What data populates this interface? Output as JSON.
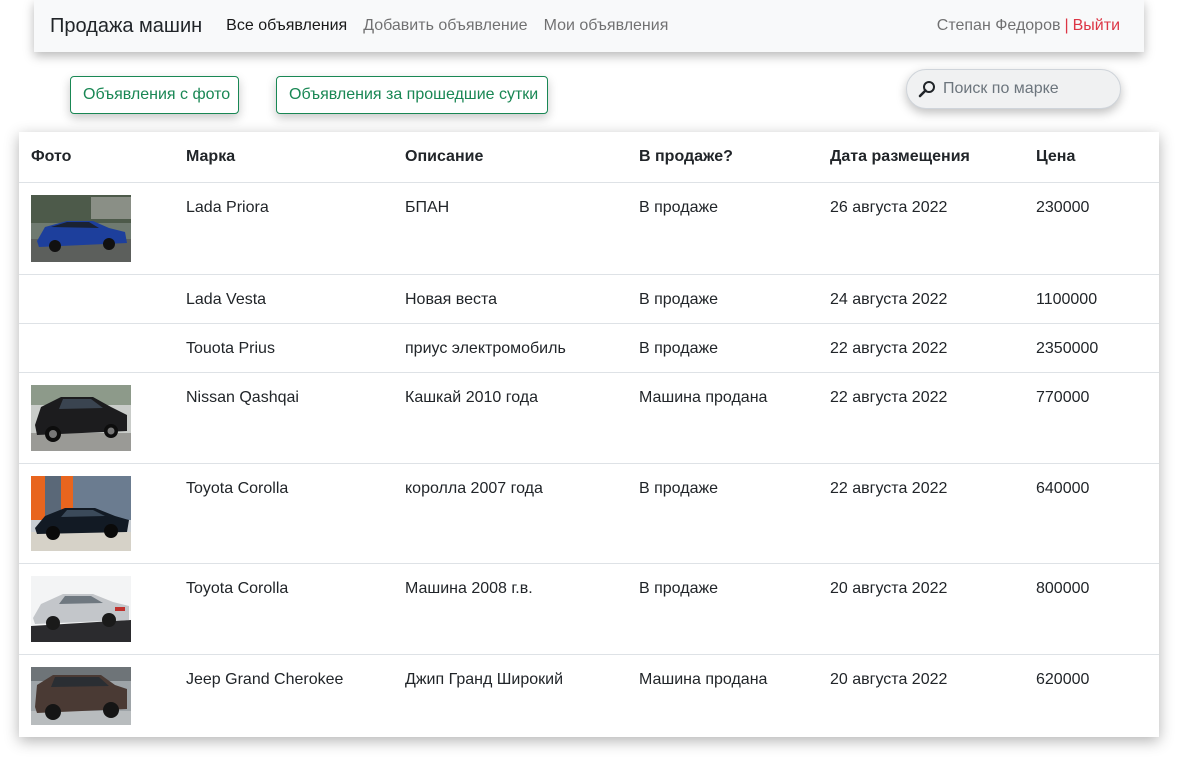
{
  "navbar": {
    "brand": "Продажа машин",
    "links": [
      {
        "label": "Все объявления",
        "active": true
      },
      {
        "label": "Добавить объявление",
        "active": false
      },
      {
        "label": "Мои объявления",
        "active": false
      }
    ],
    "user_name": "Степан Федоров",
    "separator": "|",
    "logout_label": "Выйти"
  },
  "filters": {
    "with_photo_label": "Объявления с фото",
    "last_day_label": "Объявления за прошедшие сутки"
  },
  "search": {
    "placeholder": "Поиск по марке",
    "value": "",
    "icon": "search-icon"
  },
  "table": {
    "headers": [
      "Фото",
      "Марка",
      "Описание",
      "В продаже?",
      "Дата размещения",
      "Цена"
    ],
    "rows": [
      {
        "has_photo": true,
        "photo": "blue-sedan",
        "brand": "Lada Priora",
        "description": "БПАН",
        "status": "В продаже",
        "date": "26 августа 2022",
        "price": "230000"
      },
      {
        "has_photo": false,
        "brand": "Lada Vesta",
        "description": "Новая веста",
        "status": "В продаже",
        "date": "24 августа 2022",
        "price": "1100000"
      },
      {
        "has_photo": false,
        "brand": "Touota Prius",
        "description": "приус электромобиль",
        "status": "В продаже",
        "date": "22 августа 2022",
        "price": "2350000"
      },
      {
        "has_photo": true,
        "photo": "black-suv",
        "brand": "Nissan Qashqai",
        "description": "Кашкай 2010 года",
        "status": "Машина продана",
        "date": "22 августа 2022",
        "price": "770000"
      },
      {
        "has_photo": true,
        "photo": "dark-sedan-showroom",
        "brand": "Toyota Corolla",
        "description": "королла 2007 года",
        "status": "В продаже",
        "date": "22 августа 2022",
        "price": "640000"
      },
      {
        "has_photo": true,
        "photo": "silver-sedan",
        "brand": "Toyota Corolla",
        "description": "Машина 2008 г.в.",
        "status": "В продаже",
        "date": "20 августа 2022",
        "price": "800000"
      },
      {
        "has_photo": true,
        "photo": "brown-suv",
        "brand": "Jeep Grand Cherokee",
        "description": "Джип Гранд Широкий",
        "status": "Машина продана",
        "date": "20 августа 2022",
        "price": "620000"
      }
    ]
  },
  "colors": {
    "accent_green": "#198754",
    "logout_red": "#dc3545",
    "navbar_bg": "#f8f9fa"
  }
}
